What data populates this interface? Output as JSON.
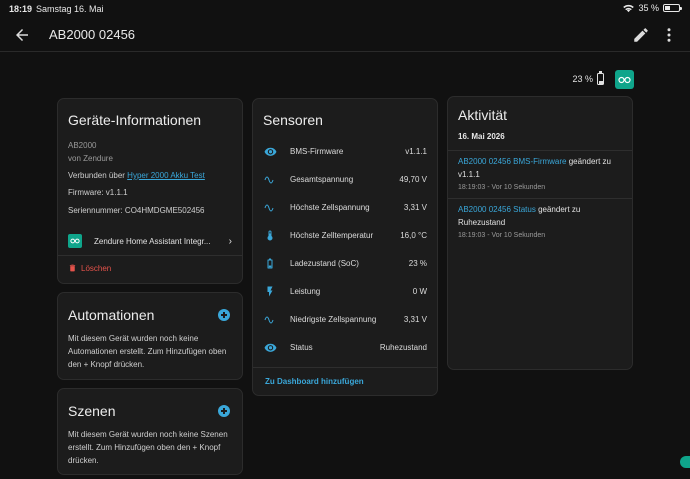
{
  "statusbar": {
    "time": "18:19",
    "date": "Samstag 16. Mai",
    "battery": "35 %",
    "battery_level": 0.35
  },
  "toolbar": {
    "title": "AB2000 02456"
  },
  "top": {
    "battery_text": "23 %",
    "battery_level": 0.23
  },
  "device": {
    "title": "Geräte-Informationen",
    "model": "AB2000",
    "manufacturer": "von Zendure",
    "connected_prefix": "Verbunden über",
    "connected_link": "Hyper 2000 Akku Test",
    "firmware": "Firmware: v1.1.1",
    "serial": "Seriennummer: CO4HMDGME502456",
    "integration": "Zendure Home Assistant Integr...",
    "delete": "Löschen"
  },
  "automations": {
    "title": "Automationen",
    "desc": "Mit diesem Gerät wurden noch keine Automationen erstellt. Zum Hinzufügen oben den + Knopf drücken."
  },
  "scenes": {
    "title": "Szenen",
    "desc": "Mit diesem Gerät wurden noch keine Szenen erstellt. Zum Hinzufügen oben den + Knopf drücken."
  },
  "sensors": {
    "title": "Sensoren",
    "rows": [
      {
        "icon": "eye-icon",
        "name": "BMS-Firmware",
        "value": "v1.1.1"
      },
      {
        "icon": "sine-wave-icon",
        "name": "Gesamtspannung",
        "value": "49,70 V"
      },
      {
        "icon": "sine-wave-icon",
        "name": "Höchste Zellspannung",
        "value": "3,31 V"
      },
      {
        "icon": "thermometer-icon",
        "name": "Höchste Zelltemperatur",
        "value": "16,0 °C"
      },
      {
        "icon": "battery-icon",
        "name": "Ladezustand (SoC)",
        "value": "23 %"
      },
      {
        "icon": "lightning-icon",
        "name": "Leistung",
        "value": "0 W"
      },
      {
        "icon": "sine-wave-icon",
        "name": "Niedrigste Zellspannung",
        "value": "3,31 V"
      },
      {
        "icon": "eye-icon",
        "name": "Status",
        "value": "Ruhezustand"
      }
    ],
    "add_to_dashboard": "Zu Dashboard hinzufügen"
  },
  "activity": {
    "title": "Aktivität",
    "date": "16. Mai 2026",
    "entries": [
      {
        "entity": "AB2000 02456 BMS-Firmware",
        "text": "geändert zu v1.1.1",
        "meta": "18:19:03 - Vor 10 Sekunden"
      },
      {
        "entity": "AB2000 02456 Status",
        "text": "geändert zu Ruhezustand",
        "meta": "18:19:03 - Vor 10 Sekunden"
      }
    ]
  },
  "colors": {
    "accent": "#3aa7d9",
    "brand": "#0fa58b",
    "danger": "#e5534b",
    "card": "#1c1c1c",
    "background": "#111111"
  }
}
